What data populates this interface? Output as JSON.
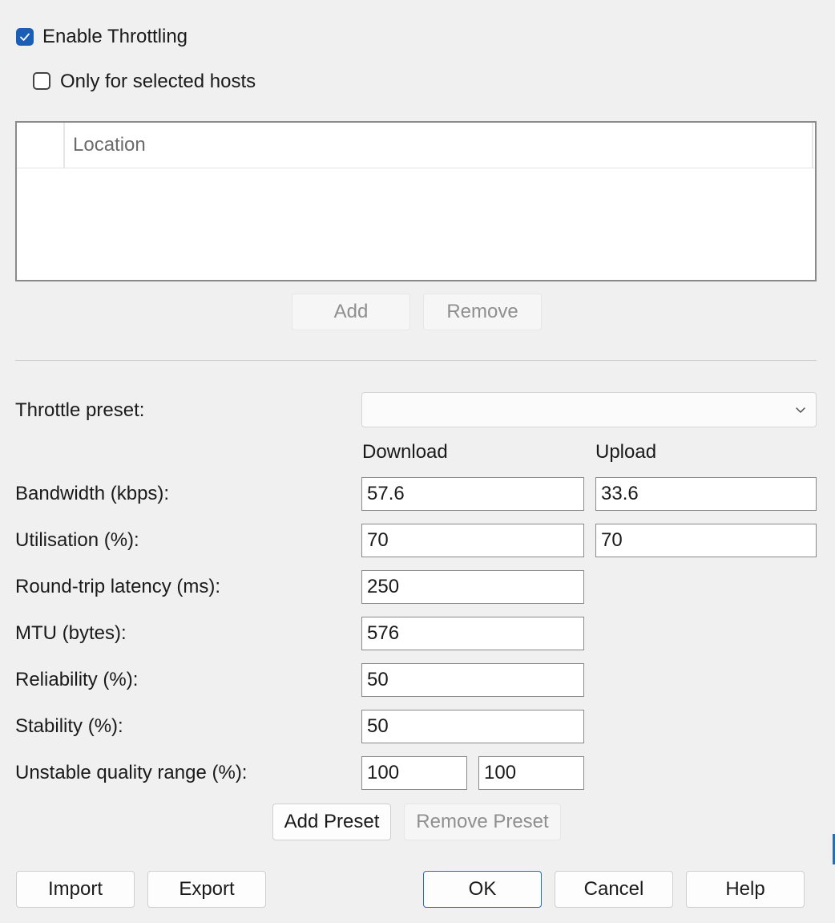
{
  "throttling": {
    "enable_label": "Enable Throttling",
    "enable_checked": true,
    "selected_hosts_label": "Only for selected hosts",
    "selected_hosts_checked": false
  },
  "hosts": {
    "column_location": "Location",
    "add_label": "Add",
    "remove_label": "Remove"
  },
  "preset": {
    "label": "Throttle preset:",
    "value": ""
  },
  "columns": {
    "download": "Download",
    "upload": "Upload"
  },
  "fields": {
    "bandwidth": {
      "label": "Bandwidth (kbps):",
      "download": "57.6",
      "upload": "33.6"
    },
    "utilisation": {
      "label": "Utilisation (%):",
      "download": "70",
      "upload": "70"
    },
    "latency": {
      "label": "Round-trip latency (ms):",
      "value": "250"
    },
    "mtu": {
      "label": "MTU (bytes):",
      "value": "576"
    },
    "reliability": {
      "label": "Reliability (%):",
      "value": "50"
    },
    "stability": {
      "label": "Stability (%):",
      "value": "50"
    },
    "unstable_range": {
      "label": "Unstable quality range (%):",
      "min": "100",
      "max": "100"
    }
  },
  "preset_buttons": {
    "add_label": "Add Preset",
    "remove_label": "Remove Preset"
  },
  "footer": {
    "import_label": "Import",
    "export_label": "Export",
    "ok_label": "OK",
    "cancel_label": "Cancel",
    "help_label": "Help"
  },
  "colors": {
    "accent": "#1a5fb4",
    "background": "#f0f0f0"
  }
}
